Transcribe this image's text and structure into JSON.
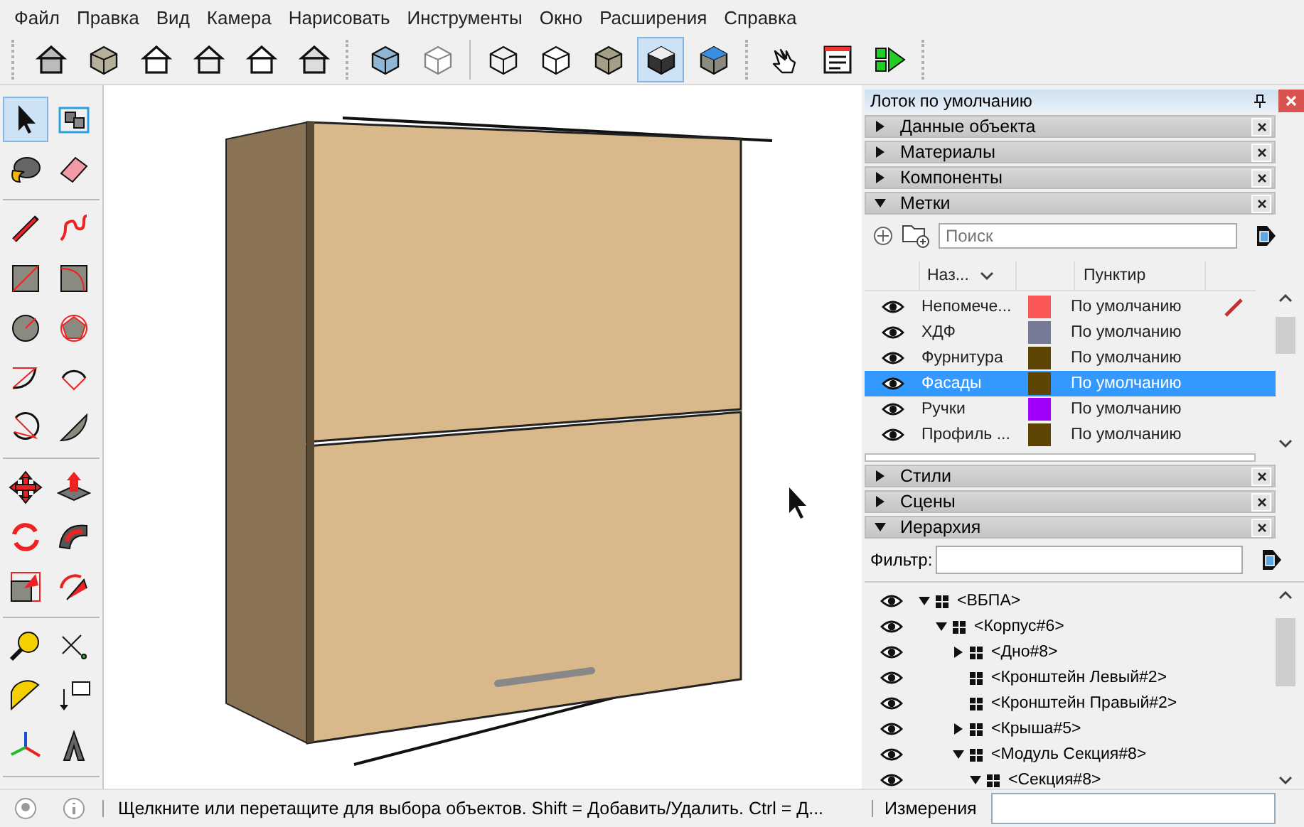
{
  "menu": [
    "Файл",
    "Правка",
    "Вид",
    "Камера",
    "Нарисовать",
    "Инструменты",
    "Окно",
    "Расширения",
    "Справка"
  ],
  "toolbar": {
    "groups": [
      [
        {
          "selected": false
        },
        {
          "selected": false
        },
        {
          "selected": false
        },
        {
          "selected": false
        },
        {
          "selected": false
        },
        {
          "selected": false
        }
      ],
      [
        {
          "selected": false
        },
        {
          "selected": false
        }
      ],
      [
        {
          "selected": false
        },
        {
          "selected": false
        },
        {
          "selected": false
        },
        {
          "selected": true
        },
        {
          "selected": false
        }
      ],
      [
        {
          "selected": false
        },
        {
          "selected": false
        },
        {
          "selected": false
        }
      ]
    ]
  },
  "tools": {
    "groups": [
      [
        {
          "selected": true
        },
        {
          "selected": false
        },
        {
          "selected": false
        },
        {
          "selected": false
        }
      ],
      [
        {
          "selected": false
        },
        {
          "selected": false
        },
        {
          "selected": false
        },
        {
          "selected": false
        },
        {
          "selected": false
        },
        {
          "selected": false
        },
        {
          "selected": false
        },
        {
          "selected": false
        },
        {
          "selected": false
        },
        {
          "selected": false
        }
      ],
      [
        {
          "selected": false
        },
        {
          "selected": false
        },
        {
          "selected": false
        },
        {
          "selected": false
        },
        {
          "selected": false
        },
        {
          "selected": false
        }
      ],
      [
        {
          "selected": false
        },
        {
          "selected": false
        },
        {
          "selected": false
        },
        {
          "selected": false
        },
        {
          "selected": false
        },
        {
          "selected": false
        }
      ]
    ]
  },
  "tray": {
    "title": "Лоток по умолчанию",
    "sections": [
      {
        "title": "Данные объекта",
        "expanded": false,
        "kind": "plain"
      },
      {
        "title": "Материалы",
        "expanded": false,
        "kind": "plain"
      },
      {
        "title": "Компоненты",
        "expanded": false,
        "kind": "plain"
      },
      {
        "title": "Метки",
        "expanded": true,
        "kind": "tags"
      },
      {
        "title": "Стили",
        "expanded": false,
        "kind": "plain"
      },
      {
        "title": "Сцены",
        "expanded": false,
        "kind": "plain"
      },
      {
        "title": "Иерархия",
        "expanded": true,
        "kind": "outliner"
      }
    ]
  },
  "tags": {
    "search": {
      "placeholder": "Поиск"
    },
    "columns": [
      "Наз...",
      "Пунктир"
    ],
    "rows": [
      {
        "name": "Непомече...",
        "color": "#fb5656",
        "dash": "По умолчанию",
        "visible": true,
        "current": true,
        "selected": false
      },
      {
        "name": "ХДФ",
        "color": "#777b97",
        "dash": "По умолчанию",
        "visible": true,
        "current": false,
        "selected": false
      },
      {
        "name": "Фурнитура",
        "color": "#5e4503",
        "dash": "По умолчанию",
        "visible": true,
        "current": false,
        "selected": false
      },
      {
        "name": "Фасады",
        "color": "#5e4503",
        "dash": "По умолчанию",
        "visible": true,
        "current": false,
        "selected": true
      },
      {
        "name": "Ручки",
        "color": "#a000f8",
        "dash": "По умолчанию",
        "visible": true,
        "current": false,
        "selected": false
      },
      {
        "name": "Профиль ...",
        "color": "#5e4503",
        "dash": "По умолчанию",
        "visible": true,
        "current": false,
        "selected": false
      }
    ]
  },
  "outliner": {
    "filter_label": "Фильтр:",
    "tree": [
      {
        "label": "<ВБПА>",
        "kind": "group",
        "expanded": true,
        "children": [
          {
            "label": "<Корпус#6>",
            "kind": "group",
            "expanded": true,
            "children": [
              {
                "label": "<Дно#8>",
                "kind": "group",
                "expanded": false
              },
              {
                "label": "<Кронштейн Левый#2>",
                "kind": "leaf"
              },
              {
                "label": "<Кронштейн Правый#2>",
                "kind": "leaf"
              },
              {
                "label": "<Крыша#5>",
                "kind": "group",
                "expanded": false
              },
              {
                "label": "<Модуль Секция#8>",
                "kind": "group",
                "expanded": true,
                "children": [
                  {
                    "label": "<Секция#8>",
                    "kind": "group",
                    "expanded": true
                  }
                ]
              }
            ]
          }
        ]
      }
    ]
  },
  "status_bar": {
    "message": "Щелкните или перетащите для выбора объектов. Shift = Добавить/Удалить. Ctrl = Д...",
    "measurements_label": "Измерения"
  }
}
